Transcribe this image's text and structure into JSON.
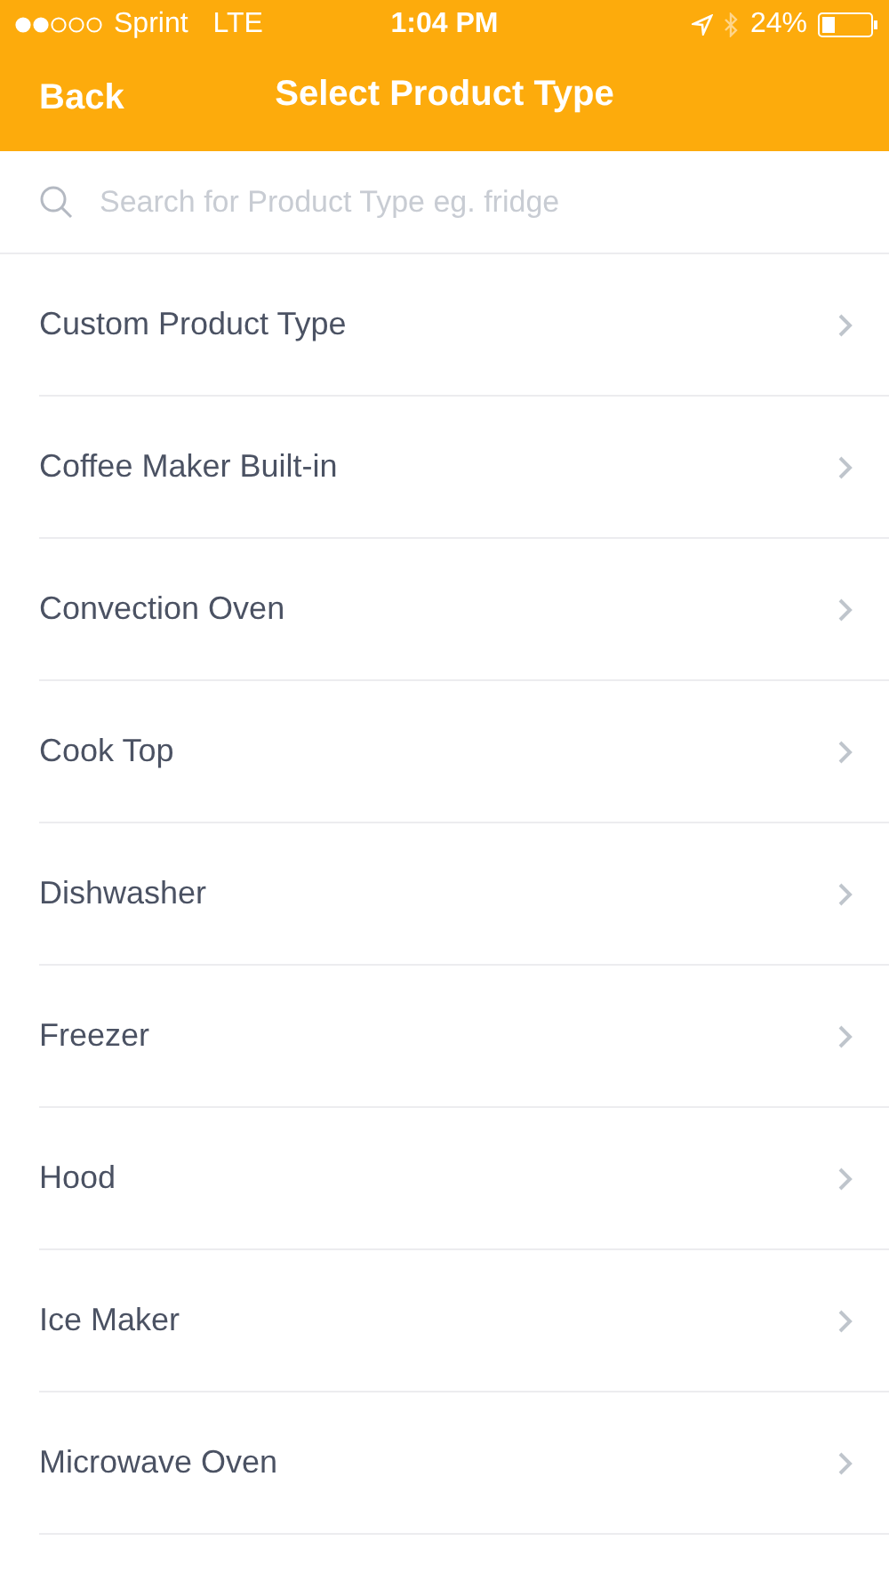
{
  "status_bar": {
    "carrier": "Sprint",
    "network": "LTE",
    "time": "1:04 PM",
    "battery": "24%"
  },
  "nav": {
    "back": "Back",
    "title": "Select Product Type"
  },
  "search": {
    "placeholder": "Search for Product Type eg. fridge"
  },
  "items": [
    {
      "label": "Custom Product Type"
    },
    {
      "label": "Coffee Maker Built-in"
    },
    {
      "label": "Convection Oven"
    },
    {
      "label": "Cook Top"
    },
    {
      "label": "Dishwasher"
    },
    {
      "label": "Freezer"
    },
    {
      "label": "Hood"
    },
    {
      "label": "Ice Maker"
    },
    {
      "label": "Microwave Oven"
    }
  ]
}
